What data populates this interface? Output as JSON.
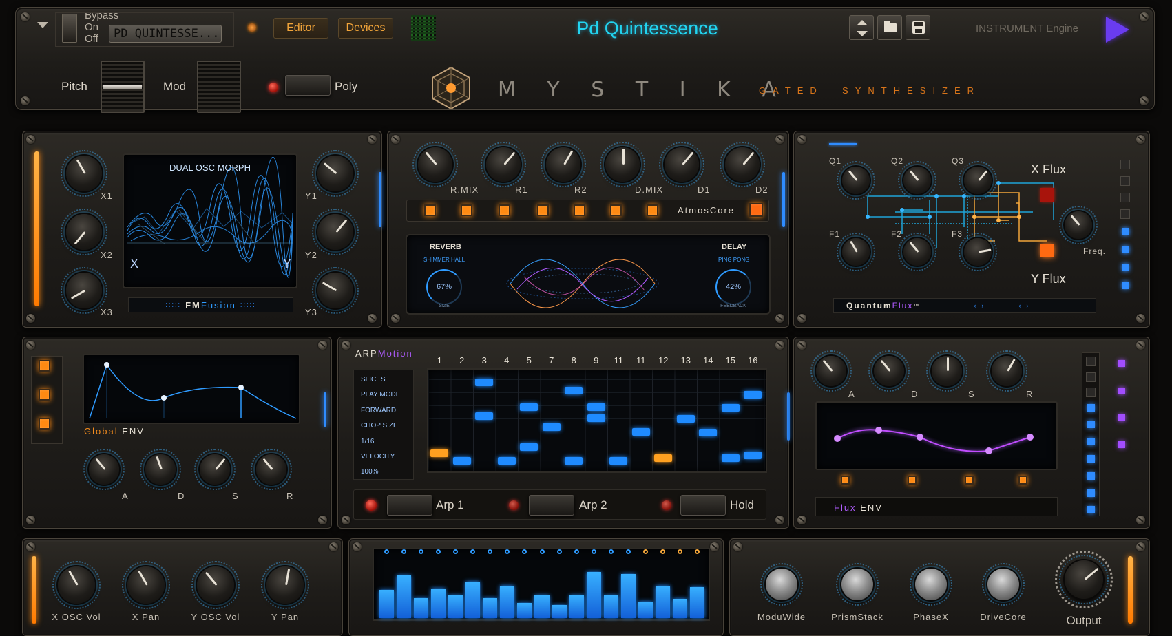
{
  "header": {
    "bypass_label": "Bypass",
    "on_label": "On",
    "off_label": "Off",
    "preset_name": "PD QUINTESSE...",
    "editor_label": "Editor",
    "devices_label": "Devices",
    "title": "Pd Quintessence",
    "engine_label": "INSTRUMENT Engine"
  },
  "brand": {
    "pitch_label": "Pitch",
    "mod_label": "Mod",
    "poly_label": "Poly",
    "name": "M Y S T I K A",
    "tagline": "GATED  SYNTHESIZER"
  },
  "fm": {
    "display_title": "DUAL OSC MORPH",
    "x_label": "X",
    "y_label": "Y",
    "knob_labels": [
      "X1",
      "X2",
      "X3",
      "Y1",
      "Y2",
      "Y3"
    ],
    "footer_a": "FM",
    "footer_b": "Fusion"
  },
  "atmos": {
    "knob_labels": [
      "R.MIX",
      "R1",
      "R2",
      "D.MIX",
      "D1",
      "D2"
    ],
    "name": "AtmosCore",
    "reverb_title": "REVERB",
    "reverb_type": "SHIMMER HALL",
    "reverb_value": "67%",
    "reverb_param": "SIZE",
    "delay_title": "DELAY",
    "delay_type": "PING PONG",
    "delay_value": "42%",
    "delay_param": "FEEDBACK"
  },
  "quantum": {
    "q_labels": [
      "Q1",
      "Q2",
      "Q3"
    ],
    "f_labels": [
      "F1",
      "F2",
      "F3"
    ],
    "x_flux": "X Flux",
    "y_flux": "Y Flux",
    "freq": "Freq.",
    "footer_a": "Quantum",
    "footer_b": "Flux",
    "footer_tm": "™"
  },
  "global_env": {
    "title_a": "Global",
    "title_b": "ENV",
    "knob_labels": [
      "A",
      "D",
      "S",
      "R"
    ]
  },
  "arp": {
    "title_a": "ARP",
    "title_b": "Motion",
    "steps": [
      "1",
      "2",
      "3",
      "4",
      "5",
      "7",
      "8",
      "9",
      "11",
      "11",
      "12",
      "13",
      "14",
      "15",
      "16"
    ],
    "params": [
      "SLICES",
      "PLAY MODE",
      "FORWARD",
      "CHOP SIZE",
      "1/16",
      "VELOCITY",
      "100%"
    ],
    "arp1": "Arp 1",
    "arp2": "Arp 2",
    "hold": "Hold",
    "grid_notes": [
      [
        0.0,
        0.85,
        "o"
      ],
      [
        1,
        0.93,
        "b"
      ],
      [
        2,
        0.08,
        "b"
      ],
      [
        2,
        0.45,
        "b"
      ],
      [
        3,
        0.93,
        "b"
      ],
      [
        4,
        0.35,
        "b"
      ],
      [
        4,
        0.78,
        "b"
      ],
      [
        5,
        0.57,
        "b"
      ],
      [
        6,
        0.93,
        "b"
      ],
      [
        6,
        0.17,
        "b"
      ],
      [
        7,
        0.35,
        "b"
      ],
      [
        7,
        0.47,
        "b"
      ],
      [
        8,
        0.93,
        "b"
      ],
      [
        9,
        0.62,
        "b"
      ],
      [
        10,
        0.9,
        "o"
      ],
      [
        11,
        0.48,
        "b"
      ],
      [
        12,
        0.63,
        "b"
      ],
      [
        13,
        0.9,
        "b"
      ],
      [
        13,
        0.36,
        "b"
      ],
      [
        14,
        0.22,
        "b"
      ],
      [
        14,
        0.87,
        "b"
      ]
    ]
  },
  "flux_env": {
    "knob_labels": [
      "A",
      "D",
      "S",
      "R"
    ],
    "title_a": "Flux",
    "title_b": "ENV"
  },
  "mixer": {
    "knob_labels": [
      "X OSC Vol",
      "X Pan",
      "Y OSC Vol",
      "Y Pan"
    ]
  },
  "spectrum": {
    "bars": [
      0.48,
      0.72,
      0.34,
      0.5,
      0.38,
      0.62,
      0.34,
      0.55,
      0.26,
      0.38,
      0.22,
      0.38,
      0.78,
      0.38,
      0.74,
      0.28,
      0.55,
      0.32,
      0.52
    ]
  },
  "fx_out": {
    "knob_labels": [
      "ModuWide",
      "PrismStack",
      "PhaseX",
      "DriveCore"
    ],
    "output_label": "Output"
  },
  "colors": {
    "accent_orange": "#ff8a12",
    "accent_blue": "#2f8cff",
    "title_cyan": "#22d4f0",
    "purple": "#b05cff"
  }
}
